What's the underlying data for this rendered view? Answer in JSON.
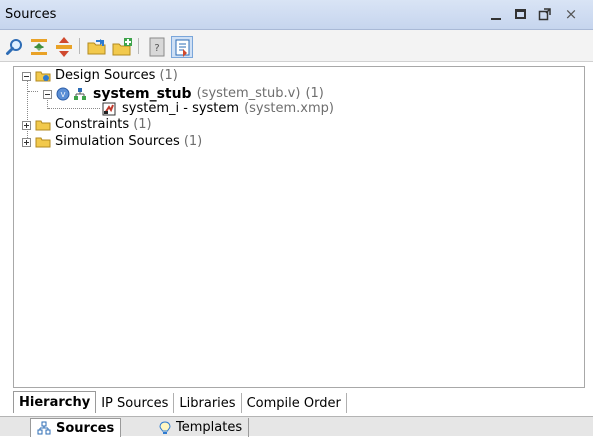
{
  "window": {
    "title": "Sources",
    "controls": [
      "minimize-icon",
      "maximize-icon",
      "restore-icon",
      "close-icon"
    ],
    "close_glyph": "×"
  },
  "toolbar": {
    "buttons": [
      "search-icon",
      "collapse-all-icon",
      "expand-all-icon",
      "open-file-icon",
      "add-sources-icon",
      "properties-icon",
      "hierarchy-view-icon"
    ]
  },
  "tree": {
    "design_sources": {
      "label": "Design Sources",
      "count": "(1)"
    },
    "system_stub": {
      "label": "system_stub",
      "file": "(system_stub.v)",
      "count": "(1)"
    },
    "system_i": {
      "label": "system_i - system",
      "file": "(system.xmp)"
    },
    "constraints": {
      "label": "Constraints",
      "count": "(1)"
    },
    "simulation_sources": {
      "label": "Simulation Sources",
      "count": "(1)"
    }
  },
  "view_tabs": {
    "hierarchy": "Hierarchy",
    "ip_sources": "IP Sources",
    "libraries": "Libraries",
    "compile_order": "Compile Order"
  },
  "panel_tabs": {
    "sources": "Sources",
    "templates": "Templates"
  },
  "colors": {
    "titlebar": "#c9d7ef",
    "selected_toolbar_button": "#7aa6da",
    "folder": "#f2c94c"
  }
}
